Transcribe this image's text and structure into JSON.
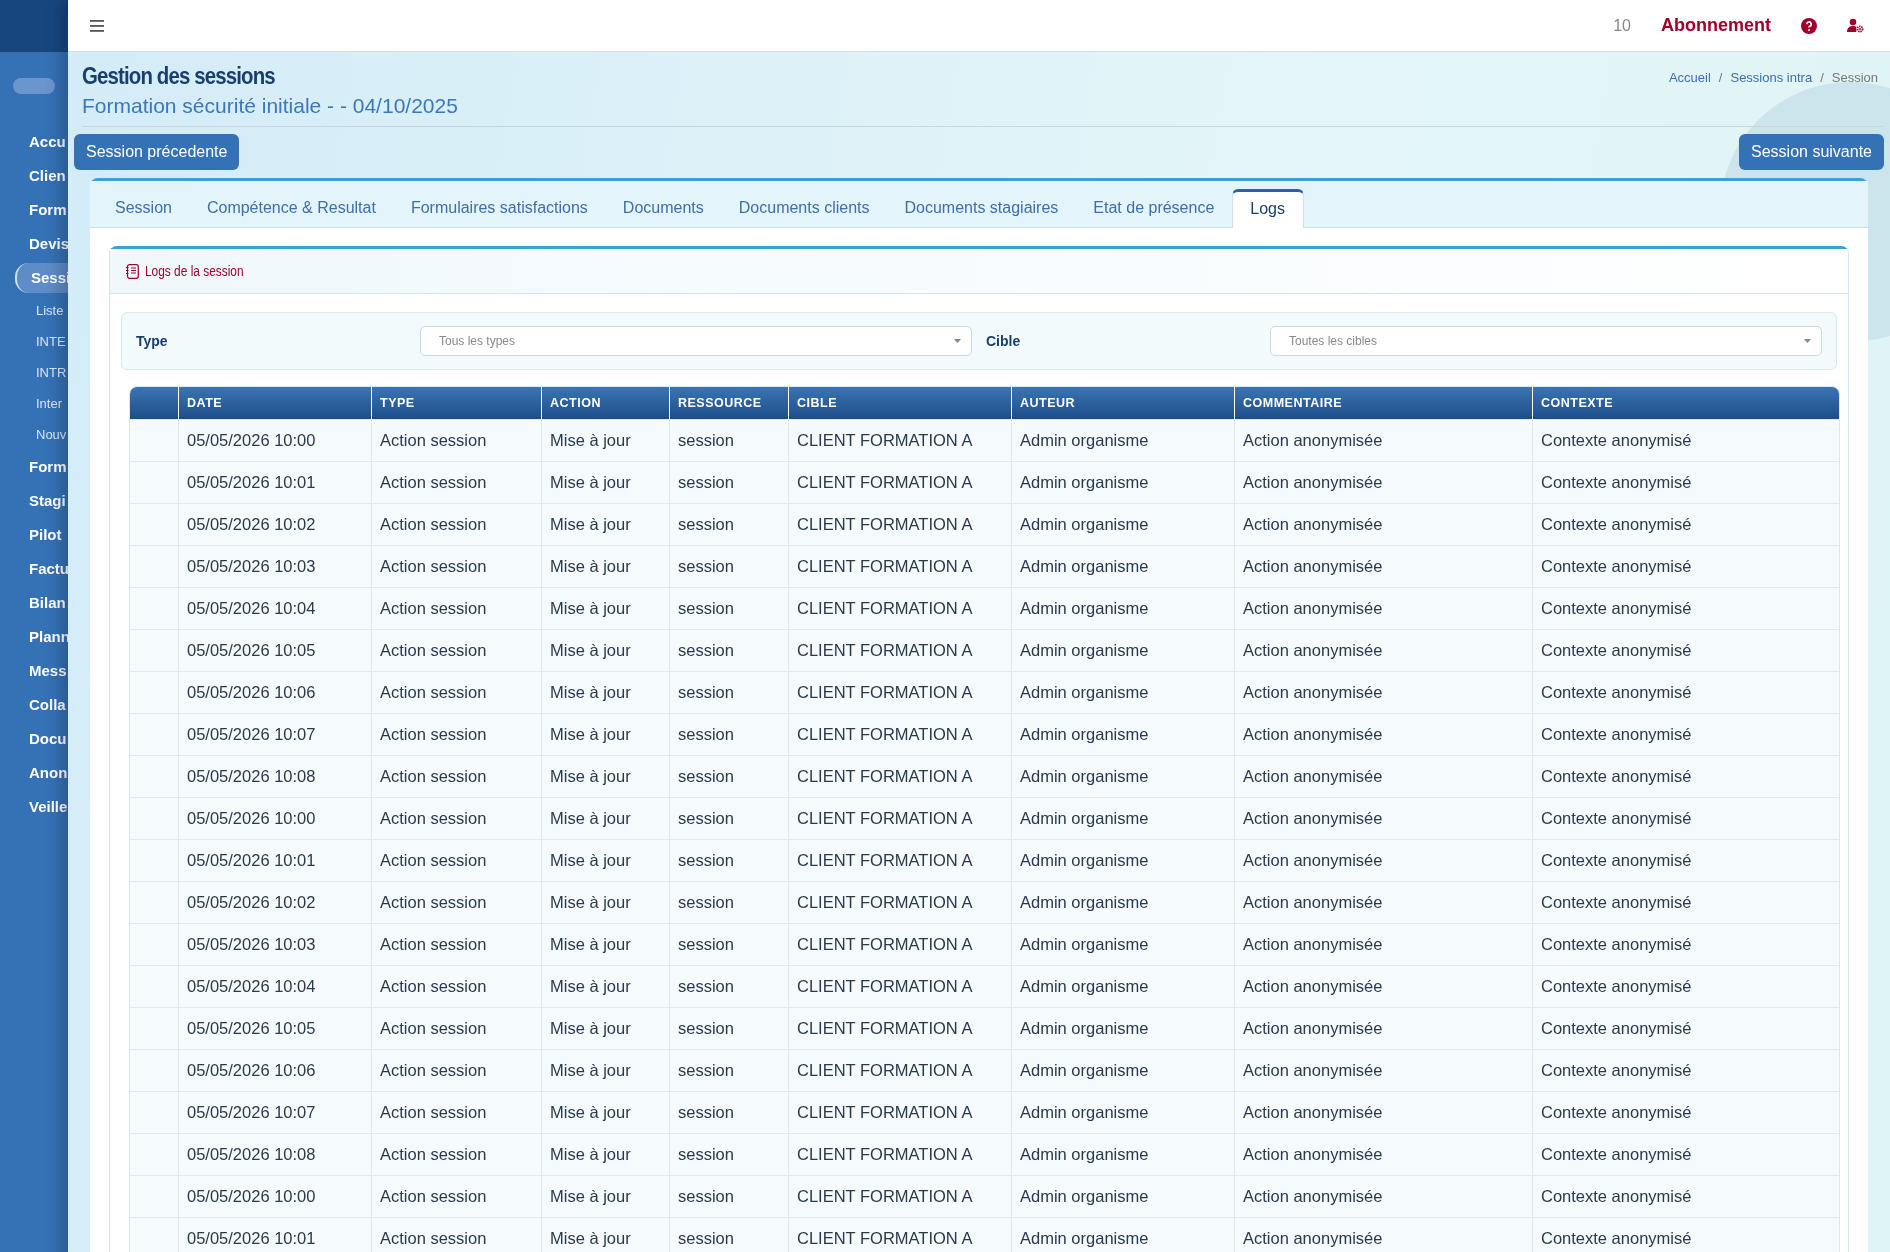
{
  "sidebar": {
    "toggle": {
      "on": false
    },
    "items": [
      {
        "label": "Accu",
        "selected": false
      },
      {
        "label": "Clien",
        "selected": false
      },
      {
        "label": "Form",
        "selected": false
      },
      {
        "label": "Devis",
        "selected": false
      },
      {
        "label": "Sessi",
        "selected": true,
        "children": [
          {
            "label": "Liste"
          },
          {
            "label": "INTE"
          },
          {
            "label": "INTR"
          },
          {
            "label": "Inter"
          },
          {
            "label": "Nouv"
          }
        ]
      },
      {
        "label": "Form",
        "selected": false
      },
      {
        "label": "Stagi",
        "selected": false
      },
      {
        "label": "Pilot",
        "selected": false
      },
      {
        "label": "Factu",
        "selected": false
      },
      {
        "label": "Bilan",
        "selected": false
      },
      {
        "label": "Plann",
        "selected": false
      },
      {
        "label": "Mess",
        "selected": false
      },
      {
        "label": "Colla",
        "selected": false
      },
      {
        "label": "Docu",
        "selected": false
      },
      {
        "label": "Anon",
        "selected": false
      },
      {
        "label": "Veille",
        "selected": false
      }
    ]
  },
  "topbar": {
    "count": "10",
    "subscription": "Abonnement"
  },
  "header": {
    "title": "Gestion des sessions",
    "subtitle": "Formation sécurité initiale - - 04/10/2025",
    "breadcrumb": [
      {
        "label": "Accueil",
        "kind": "link"
      },
      {
        "label": "Sessions intra",
        "kind": "link",
        "separator": "/"
      },
      {
        "label": "Session",
        "kind": "current",
        "separator": "/"
      }
    ]
  },
  "nav_buttons": {
    "previous": "Session précedente",
    "next": "Session suivante"
  },
  "tabs": [
    {
      "label": "Session",
      "selected": false
    },
    {
      "label": "Compétence & Resultat",
      "selected": false
    },
    {
      "label": "Formulaires satisfactions",
      "selected": false
    },
    {
      "label": "Documents",
      "selected": false
    },
    {
      "label": "Documents clients",
      "selected": false
    },
    {
      "label": "Documents stagiaires",
      "selected": false
    },
    {
      "label": "Etat de présence",
      "selected": false
    },
    {
      "label": "Logs",
      "selected": true
    }
  ],
  "logs_card": {
    "title": "Logs de la session",
    "filters": [
      {
        "label": "Type",
        "placeholder": "Tous les types"
      },
      {
        "label": "Cible",
        "placeholder": "Toutes les cibles"
      }
    ],
    "table": {
      "columns": [
        "DATE",
        "TYPE",
        "ACTION",
        "RESSOURCE",
        "CIBLE",
        "AUTEUR",
        "COMMENTAIRE",
        "CONTEXTE"
      ],
      "rows": [
        [
          "05/05/2026 10:00",
          "Action session",
          "Mise à jour",
          "session",
          "CLIENT FORMATION A",
          "Admin organisme",
          "Action anonymisée",
          "Contexte anonymisé"
        ],
        [
          "05/05/2026 10:01",
          "Action session",
          "Mise à jour",
          "session",
          "CLIENT FORMATION A",
          "Admin organisme",
          "Action anonymisée",
          "Contexte anonymisé"
        ],
        [
          "05/05/2026 10:02",
          "Action session",
          "Mise à jour",
          "session",
          "CLIENT FORMATION A",
          "Admin organisme",
          "Action anonymisée",
          "Contexte anonymisé"
        ],
        [
          "05/05/2026 10:03",
          "Action session",
          "Mise à jour",
          "session",
          "CLIENT FORMATION A",
          "Admin organisme",
          "Action anonymisée",
          "Contexte anonymisé"
        ],
        [
          "05/05/2026 10:04",
          "Action session",
          "Mise à jour",
          "session",
          "CLIENT FORMATION A",
          "Admin organisme",
          "Action anonymisée",
          "Contexte anonymisé"
        ],
        [
          "05/05/2026 10:05",
          "Action session",
          "Mise à jour",
          "session",
          "CLIENT FORMATION A",
          "Admin organisme",
          "Action anonymisée",
          "Contexte anonymisé"
        ],
        [
          "05/05/2026 10:06",
          "Action session",
          "Mise à jour",
          "session",
          "CLIENT FORMATION A",
          "Admin organisme",
          "Action anonymisée",
          "Contexte anonymisé"
        ],
        [
          "05/05/2026 10:07",
          "Action session",
          "Mise à jour",
          "session",
          "CLIENT FORMATION A",
          "Admin organisme",
          "Action anonymisée",
          "Contexte anonymisé"
        ],
        [
          "05/05/2026 10:08",
          "Action session",
          "Mise à jour",
          "session",
          "CLIENT FORMATION A",
          "Admin organisme",
          "Action anonymisée",
          "Contexte anonymisé"
        ],
        [
          "05/05/2026 10:00",
          "Action session",
          "Mise à jour",
          "session",
          "CLIENT FORMATION A",
          "Admin organisme",
          "Action anonymisée",
          "Contexte anonymisé"
        ],
        [
          "05/05/2026 10:01",
          "Action session",
          "Mise à jour",
          "session",
          "CLIENT FORMATION A",
          "Admin organisme",
          "Action anonymisée",
          "Contexte anonymisé"
        ],
        [
          "05/05/2026 10:02",
          "Action session",
          "Mise à jour",
          "session",
          "CLIENT FORMATION A",
          "Admin organisme",
          "Action anonymisée",
          "Contexte anonymisé"
        ],
        [
          "05/05/2026 10:03",
          "Action session",
          "Mise à jour",
          "session",
          "CLIENT FORMATION A",
          "Admin organisme",
          "Action anonymisée",
          "Contexte anonymisé"
        ],
        [
          "05/05/2026 10:04",
          "Action session",
          "Mise à jour",
          "session",
          "CLIENT FORMATION A",
          "Admin organisme",
          "Action anonymisée",
          "Contexte anonymisé"
        ],
        [
          "05/05/2026 10:05",
          "Action session",
          "Mise à jour",
          "session",
          "CLIENT FORMATION A",
          "Admin organisme",
          "Action anonymisée",
          "Contexte anonymisé"
        ],
        [
          "05/05/2026 10:06",
          "Action session",
          "Mise à jour",
          "session",
          "CLIENT FORMATION A",
          "Admin organisme",
          "Action anonymisée",
          "Contexte anonymisé"
        ],
        [
          "05/05/2026 10:07",
          "Action session",
          "Mise à jour",
          "session",
          "CLIENT FORMATION A",
          "Admin organisme",
          "Action anonymisée",
          "Contexte anonymisé"
        ],
        [
          "05/05/2026 10:08",
          "Action session",
          "Mise à jour",
          "session",
          "CLIENT FORMATION A",
          "Admin organisme",
          "Action anonymisée",
          "Contexte anonymisé"
        ],
        [
          "05/05/2026 10:00",
          "Action session",
          "Mise à jour",
          "session",
          "CLIENT FORMATION A",
          "Admin organisme",
          "Action anonymisée",
          "Contexte anonymisé"
        ],
        [
          "05/05/2026 10:01",
          "Action session",
          "Mise à jour",
          "session",
          "CLIENT FORMATION A",
          "Admin organisme",
          "Action anonymisée",
          "Contexte anonymisé"
        ]
      ]
    }
  }
}
